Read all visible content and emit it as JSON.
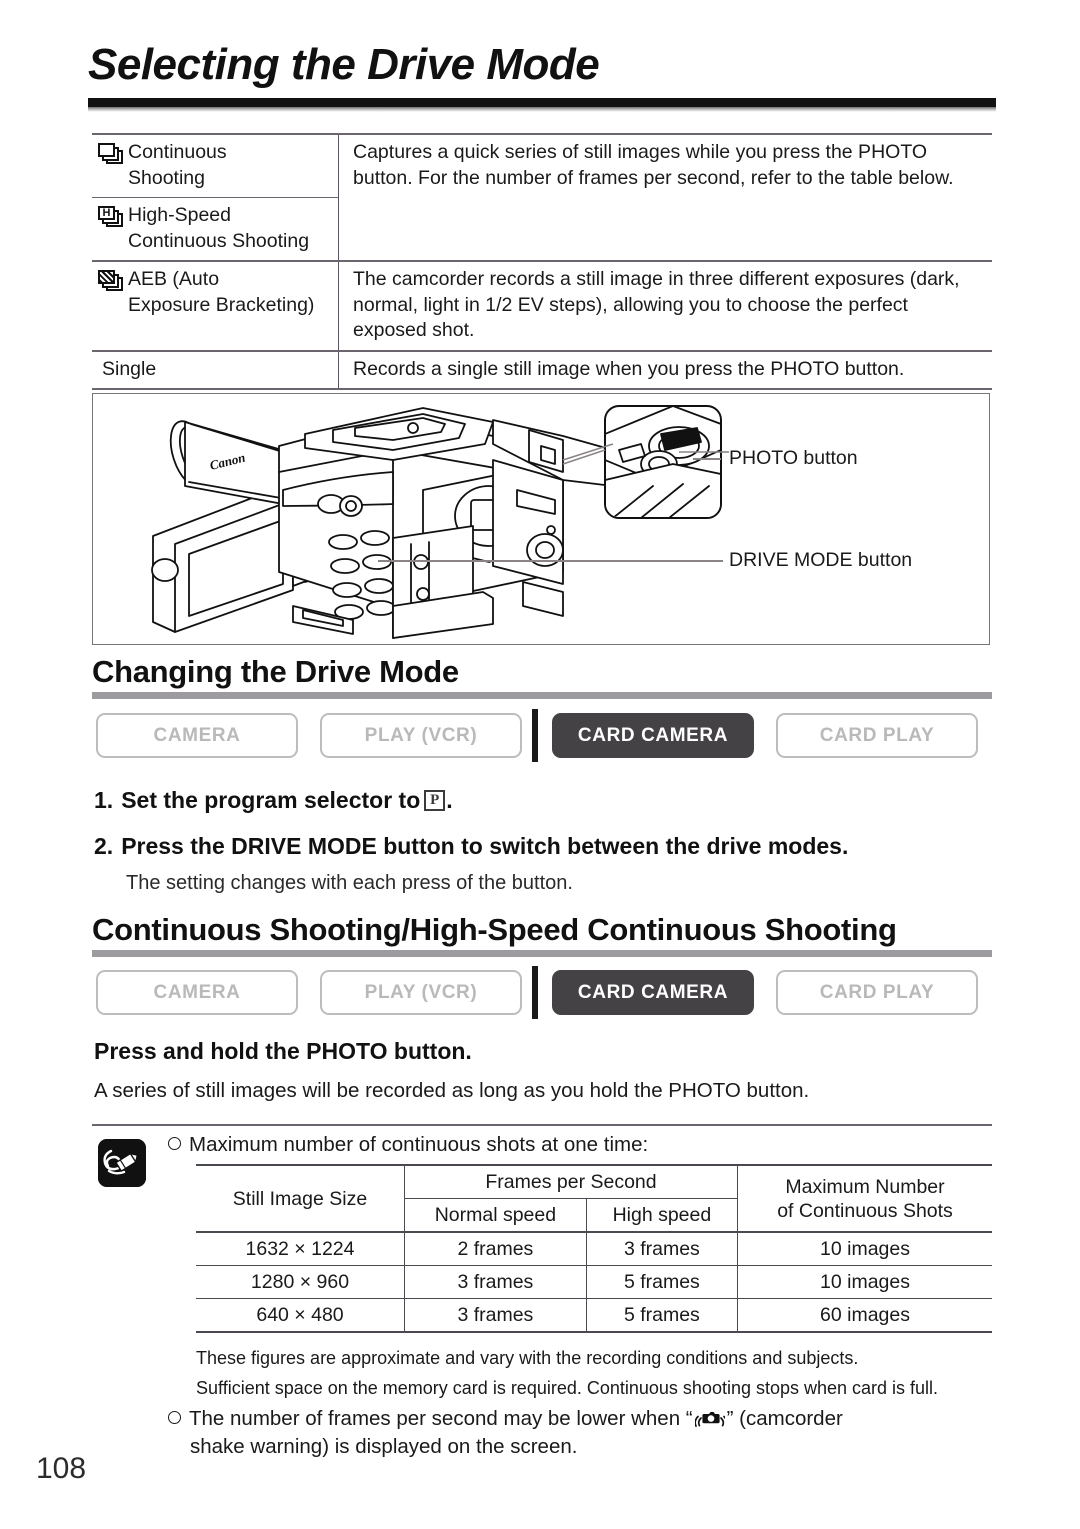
{
  "page": {
    "title": "Selecting the Drive Mode",
    "number": "108"
  },
  "drive_mode_table": {
    "rows": [
      {
        "icons": [
          "continuous-shooting-icon",
          "high-speed-continuous-shooting-icon"
        ],
        "names": [
          "Continuous Shooting",
          "High-Speed Continuous Shooting"
        ],
        "name_line1": "Continuous",
        "name_line2": "Shooting",
        "name2_line1": "High-Speed",
        "name2_line2": "Continuous Shooting",
        "description": "Captures a quick series of still images while you press the PHOTO button. For the number of frames per second, refer to the table below."
      },
      {
        "icon": "aeb-icon",
        "name_line1": "AEB (Auto",
        "name_line2": "Exposure Bracketing)",
        "description": "The camcorder records a still image in three different exposures (dark, normal, light in 1/2 EV steps), allowing you to choose the perfect exposed shot."
      },
      {
        "icon": "",
        "name_line1": "Single",
        "name_line2": "",
        "description": "Records a single still image when you press the PHOTO button."
      }
    ]
  },
  "illustration": {
    "callouts": [
      {
        "label": "PHOTO button"
      },
      {
        "label": "DRIVE MODE button"
      }
    ],
    "brand_logo": "Canon"
  },
  "section_changing": {
    "heading": "Changing the Drive Mode",
    "badges": [
      {
        "label": "CAMERA",
        "active": false
      },
      {
        "label": "PLAY (VCR)",
        "active": false
      },
      {
        "label": "CARD CAMERA",
        "active": true
      },
      {
        "label": "CARD PLAY",
        "active": false
      }
    ],
    "steps": [
      {
        "num": "1.",
        "text_before": "Set the program selector to",
        "icon": "program-P-icon",
        "icon_label": "P",
        "text_after": "."
      },
      {
        "num": "2.",
        "text_before": "Press the DRIVE MODE button to switch between the drive modes.",
        "icon": "",
        "icon_label": "",
        "text_after": ""
      }
    ],
    "step_note": "The setting changes with each press of the button."
  },
  "section_continuous": {
    "heading": "Continuous Shooting/High-Speed Continuous Shooting",
    "badges": [
      {
        "label": "CAMERA",
        "active": false
      },
      {
        "label": "PLAY (VCR)",
        "active": false
      },
      {
        "label": "CARD CAMERA",
        "active": true
      },
      {
        "label": "CARD PLAY",
        "active": false
      }
    ],
    "instruction": "Press and hold the PHOTO button.",
    "body": "A series of still images will be recorded as long as you hold the PHOTO button."
  },
  "notes": {
    "icon": "notes-pencil-icon",
    "bullet1": "Maximum number of continuous shots at one time:",
    "footnote1": "These figures are approximate and vary with the recording conditions and subjects.",
    "footnote2": "Sufficient space on the memory card is required. Continuous shooting stops when card is full.",
    "bullet2_before": "The number of frames per second may be lower when “",
    "bullet2_icon": "camcorder-shake-warning-icon",
    "bullet2_after": "” (camcorder",
    "bullet2_line2": "shake warning) is displayed on the screen."
  },
  "spec_table": {
    "headers": {
      "col1": "Still Image Size",
      "col2_group": "Frames per Second",
      "col2a": "Normal speed",
      "col2b": "High speed",
      "col3_line1": "Maximum Number",
      "col3_line2": "of Continuous Shots"
    },
    "rows": [
      {
        "size": "1632 × 1224",
        "normal": "2 frames",
        "high": "3 frames",
        "max": "10 images"
      },
      {
        "size": "1280 × 960",
        "normal": "3 frames",
        "high": "5 frames",
        "max": "10 images"
      },
      {
        "size": "640 × 480",
        "normal": "3 frames",
        "high": "5 frames",
        "max": "60 images"
      }
    ]
  },
  "colors": {
    "active_badge_bg": "#454246",
    "inactive_badge_border": "#bdbdbd",
    "heading_rule": "#9d9aa0",
    "table_rule": "#4d4750"
  }
}
